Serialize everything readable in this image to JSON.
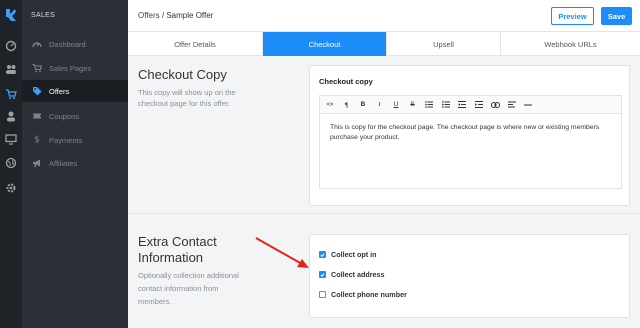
{
  "sidebar": {
    "section_label": "SALES",
    "items": [
      {
        "label": "Dashboard",
        "icon": "dashboard-icon",
        "active": false
      },
      {
        "label": "Sales Pages",
        "icon": "cart-icon",
        "active": false
      },
      {
        "label": "Offers",
        "icon": "tag-icon",
        "active": true
      },
      {
        "label": "Coupons",
        "icon": "ticket-icon",
        "active": false
      },
      {
        "label": "Payments",
        "icon": "dollar-icon",
        "active": false
      },
      {
        "label": "Affiliates",
        "icon": "megaphone-icon",
        "active": false
      }
    ]
  },
  "header": {
    "breadcrumb_parent": "Offers",
    "breadcrumb_sep": "/",
    "breadcrumb_current": "Sample Offer",
    "preview_label": "Preview",
    "save_label": "Save"
  },
  "tabs": [
    {
      "label": "Offer Details",
      "active": false
    },
    {
      "label": "Checkout",
      "active": true
    },
    {
      "label": "Upsell",
      "active": false
    },
    {
      "label": "Webhook URLs",
      "active": false
    }
  ],
  "checkout_copy": {
    "title": "Checkout Copy",
    "description_line1": "This copy will show up on the",
    "description_line2": "checkout page for this offer.",
    "card_title": "Checkout copy",
    "editor_line1": "This is copy for the checkout page. The checkout page is where new or existing members",
    "editor_line2": "purchase your product."
  },
  "extra_contact": {
    "title_line1": "Extra Contact",
    "title_line2": "Information",
    "description_line1": "Optionally collection additional",
    "description_line2": "contact information from",
    "description_line3": "members.",
    "options": [
      {
        "label": "Collect opt in",
        "checked": true
      },
      {
        "label": "Collect address",
        "checked": true
      },
      {
        "label": "Collect phone number",
        "checked": false
      }
    ]
  },
  "colors": {
    "accent": "#1d8cf8",
    "sidebar_bg": "#2b3036",
    "rail_bg": "#1f2328",
    "arrow": "#e8221b"
  }
}
